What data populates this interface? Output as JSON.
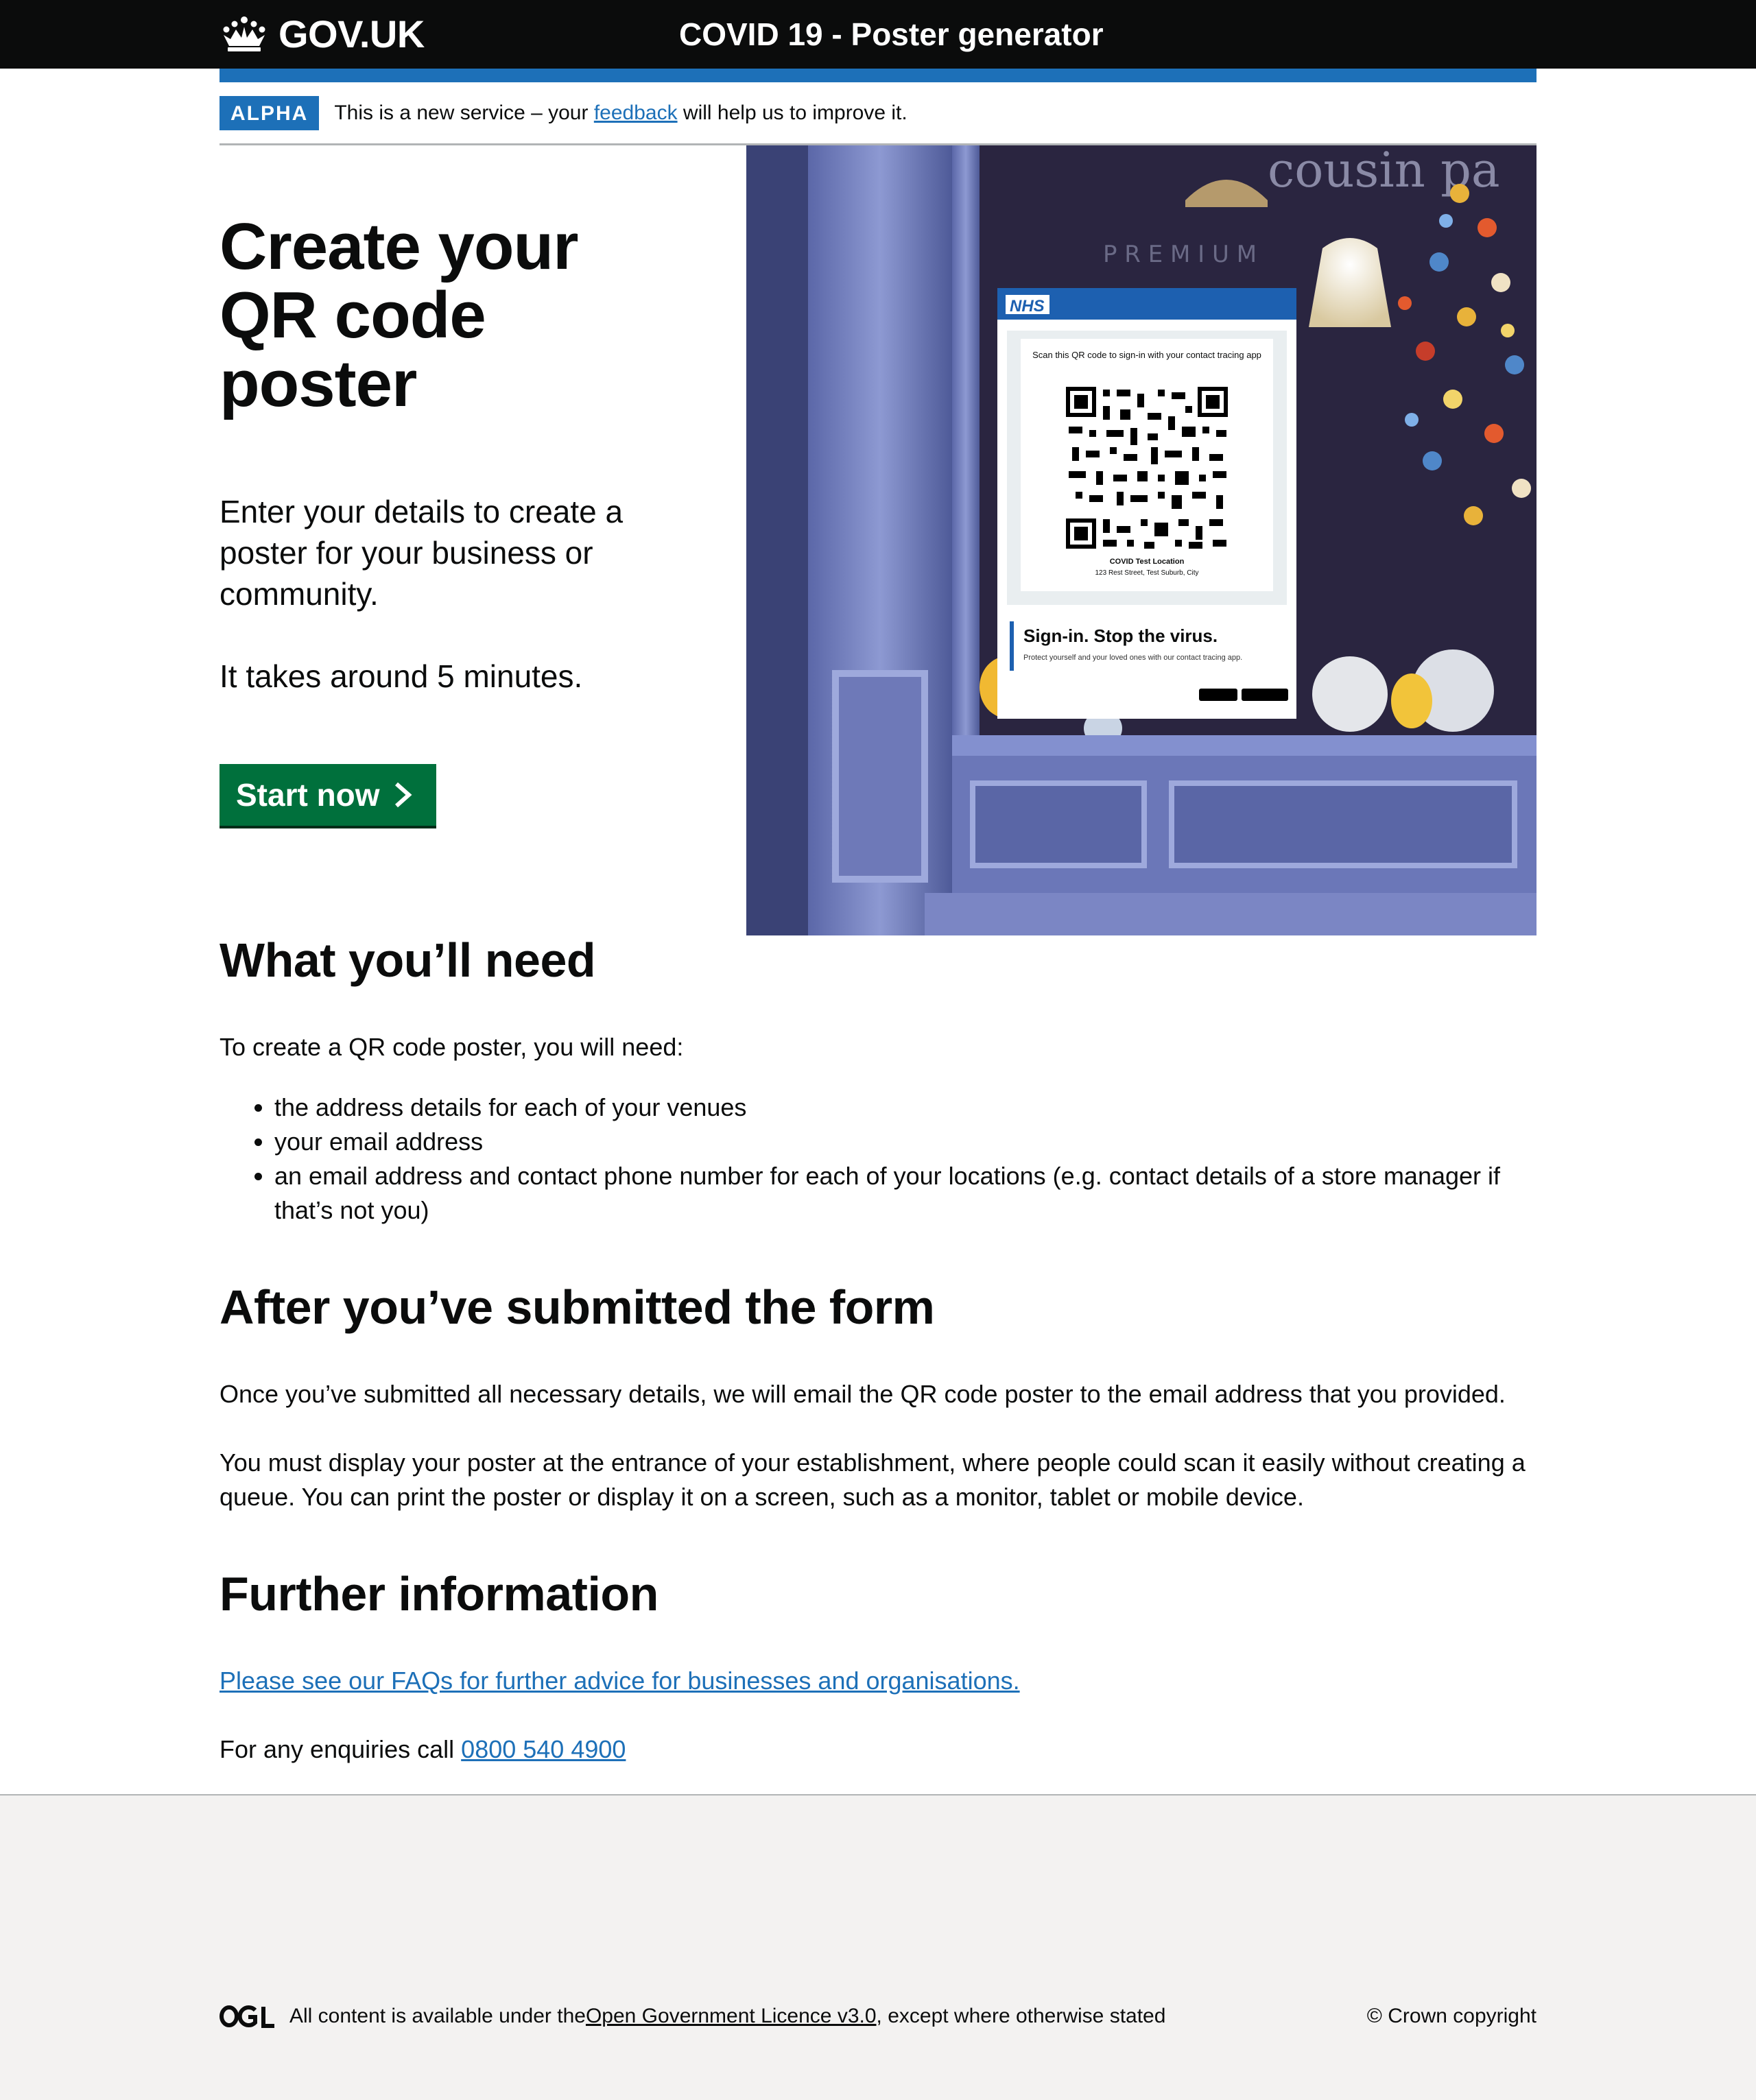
{
  "header": {
    "logo_text": "GOV.UK",
    "service_name": "COVID 19 - Poster generator"
  },
  "phase_banner": {
    "tag": "ALPHA",
    "text_before": "This is a new service – your ",
    "link": "feedback",
    "text_after": " will help us to improve it."
  },
  "hero": {
    "title": "Create your QR code poster",
    "lead": "Enter your details to create a poster for your business or community.",
    "time": "It takes around 5 minutes.",
    "start_button": "Start now"
  },
  "poster_image": {
    "nhs_logo": "NHS",
    "scan_text": "Scan this QR code to sign-in with your contact tracing app",
    "location_name": "COVID Test Location",
    "location_address": "123 Rest Street, Test Suburb, City",
    "slogan": "Sign-in. Stop the virus.",
    "subtext": "Protect yourself and your loved ones with our contact tracing app.",
    "sign_text": "cousin pa",
    "premium_text": "P R E M I U M"
  },
  "needs": {
    "heading": "What you’ll need",
    "intro": "To create a QR code poster, you will need:",
    "items": [
      "the address details for each of your venues",
      "your email address",
      "an email address and contact phone number for each of your locations (e.g. contact details of a store manager if that’s not you)"
    ]
  },
  "after": {
    "heading": "After you’ve submitted the form",
    "p1": "Once you’ve submitted all necessary details, we will email the QR code poster to the email address that you provided.",
    "p2": "You must display your poster at the entrance of your establishment, where people could scan it easily without creating a queue. You can print the poster or display it on a screen, such as a monitor, tablet or mobile device."
  },
  "further": {
    "heading": "Further information",
    "faq_link": "Please see our FAQs for further advice for businesses and organisations.",
    "enquiries_text": "For any enquiries call ",
    "phone": "0800 540 4900"
  },
  "footer": {
    "logo": "OGL",
    "licence_before": "All content is available under the ",
    "licence_link": "Open Government Licence v3.0",
    "licence_after": ", except where otherwise stated",
    "copyright": "© Crown copyright"
  },
  "colors": {
    "header_bg": "#0b0c0c",
    "brand_blue": "#1d70b8",
    "button_green": "#00703c",
    "footer_bg": "#f3f2f1"
  }
}
